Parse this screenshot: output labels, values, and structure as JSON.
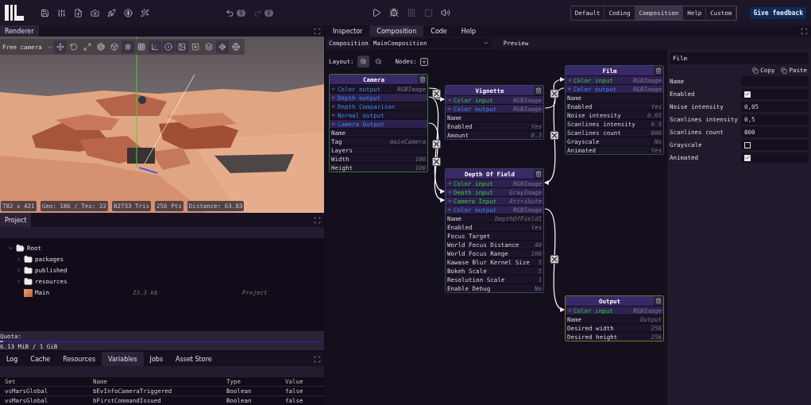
{
  "toolbar": {
    "undo_count": "0",
    "redo_count": "0",
    "layouts": [
      {
        "label": "Default",
        "selected": false
      },
      {
        "label": "Coding",
        "selected": false
      },
      {
        "label": "Composition",
        "selected": true
      },
      {
        "label": "Help",
        "selected": false
      },
      {
        "label": "Custom",
        "selected": false
      }
    ],
    "feedback": "Give feedback"
  },
  "renderer": {
    "tab": "Renderer",
    "camera": "Free camera",
    "tools": [
      {
        "selected": true
      },
      {
        "selected": false
      },
      {
        "selected": false
      },
      {
        "selected": false
      },
      {
        "selected": false
      },
      {
        "selected": true
      },
      {
        "selected": false
      },
      {
        "selected": true
      },
      {
        "selected": true
      },
      {
        "selected": true
      },
      {
        "selected": false
      },
      {
        "selected": false
      },
      {
        "selected": true
      },
      {
        "selected": false
      }
    ],
    "stats": [
      "782 x 421",
      "Geo: 186 / Tex: 22",
      "82733 Tris",
      "256 Pts",
      "Distance: 63.83"
    ]
  },
  "project": {
    "tab": "Project",
    "tree": [
      {
        "label": "Root",
        "kind": "folder",
        "expanded": true,
        "children": [
          {
            "label": "packages",
            "kind": "folder",
            "expanded": false
          },
          {
            "label": "published",
            "kind": "folder",
            "expanded": false
          },
          {
            "label": "resources",
            "kind": "folder",
            "expanded": false
          },
          {
            "label": "Main",
            "kind": "file",
            "size": "23.3 kb",
            "type": "Project"
          }
        ]
      }
    ],
    "quota_label": "Quota:",
    "quota": "6.13 MiB / 1 GiB",
    "quota_bar": {
      "level": 0.006
    }
  },
  "bottom": {
    "tabs": [
      {
        "label": "Log",
        "selected": false
      },
      {
        "label": "Cache",
        "selected": false
      },
      {
        "label": "Resources",
        "selected": false
      },
      {
        "label": "Variables",
        "selected": true
      },
      {
        "label": "Jobs",
        "selected": false
      },
      {
        "label": "Asset Store",
        "selected": false
      }
    ],
    "columns": [
      "Set",
      "Name",
      "Type",
      "Value"
    ],
    "rows": [
      [
        "vsMarsGlobal",
        "bEvInfoCameraTriggered",
        "Boolean",
        "false"
      ],
      [
        "vsMarsGlobal",
        "bFirstCommandIssued",
        "Boolean",
        "false"
      ]
    ]
  },
  "editor": {
    "tabs": [
      {
        "label": "Inspector",
        "selected": false
      },
      {
        "label": "Composition",
        "selected": true
      },
      {
        "label": "Code",
        "selected": false
      },
      {
        "label": "Help",
        "selected": false
      }
    ],
    "composition_label": "Composition",
    "composition": "MainComposition",
    "preview": "Preview",
    "layout_label": "Layout:",
    "nodes_label": "Nodes:",
    "nodes": [
      {
        "title": "Camera",
        "color": "#2e7d32",
        "rows": [
          {
            "kind": "output",
            "label": "Color output",
            "value": "RGBImage",
            "highlighted": false
          },
          {
            "kind": "output",
            "label": "Depth output",
            "highlighted": true
          },
          {
            "kind": "output",
            "label": "Depth Comparison",
            "highlighted": false
          },
          {
            "kind": "output",
            "label": "Normal output",
            "highlighted": false
          },
          {
            "kind": "output",
            "label": "Camera Output",
            "highlighted": true
          },
          {
            "kind": "property",
            "label": "Name"
          },
          {
            "kind": "property",
            "label": "Tag",
            "value": "mainCamera"
          },
          {
            "kind": "property",
            "label": "Layers"
          },
          {
            "kind": "property",
            "label": "Width",
            "value": "100"
          },
          {
            "kind": "property",
            "label": "Height",
            "value": "100"
          }
        ]
      },
      {
        "title": "Vignette",
        "color": "#2f4a5e",
        "rows": [
          {
            "kind": "input",
            "label": "Color input",
            "value": "RGBImage",
            "highlighted": true
          },
          {
            "kind": "output",
            "label": "Color output",
            "value": "RGBImage",
            "highlighted": true
          },
          {
            "kind": "property",
            "label": "Name"
          },
          {
            "kind": "property",
            "label": "Enabled",
            "value": "Yes"
          },
          {
            "kind": "property",
            "label": "Amount",
            "value": "0.3"
          }
        ]
      },
      {
        "title": "Film",
        "color": "#2f4a5e",
        "rows": [
          {
            "kind": "input",
            "label": "Color input",
            "value": "RGBImage",
            "highlighted": true
          },
          {
            "kind": "output",
            "label": "Color output",
            "value": "RGBImage",
            "highlighted": true
          },
          {
            "kind": "property",
            "label": "Name"
          },
          {
            "kind": "property",
            "label": "Enabled",
            "value": "Yes"
          },
          {
            "kind": "property",
            "label": "Noise intensity",
            "value": "0.05"
          },
          {
            "kind": "property",
            "label": "Scanlines intensity",
            "value": "0.5"
          },
          {
            "kind": "property",
            "label": "Scanlines count",
            "value": "800"
          },
          {
            "kind": "property",
            "label": "Grayscale",
            "value": "No"
          },
          {
            "kind": "property",
            "label": "Animated",
            "value": "Yes"
          }
        ]
      },
      {
        "title": "Depth Of Field",
        "color": "#2f4a5e",
        "rows": [
          {
            "kind": "input",
            "label": "Color input",
            "value": "RGBImage",
            "highlighted": true
          },
          {
            "kind": "input",
            "label": "Depth input",
            "value": "GrayImage",
            "highlighted": true
          },
          {
            "kind": "input",
            "label": "Camera Input",
            "value": "Attribute",
            "highlighted": true
          },
          {
            "kind": "output",
            "label": "Color output",
            "value": "RGBImage",
            "highlighted": true
          },
          {
            "kind": "property",
            "label": "Name",
            "value": "DepthOfField1"
          },
          {
            "kind": "property",
            "label": "Enabled",
            "value": "Yes"
          },
          {
            "kind": "property",
            "label": "Focus Target"
          },
          {
            "kind": "property",
            "label": "World Focus Distance",
            "value": "40"
          },
          {
            "kind": "property",
            "label": "World Focus Range",
            "value": "100"
          },
          {
            "kind": "property",
            "label": "Kawase Blur Kernel Size",
            "value": "5"
          },
          {
            "kind": "property",
            "label": "Bokeh Scale",
            "value": "5"
          },
          {
            "kind": "property",
            "label": "Resolution Scale",
            "value": "1"
          },
          {
            "kind": "property",
            "label": "Enable Debug",
            "value": "No"
          }
        ]
      },
      {
        "title": "Output",
        "color": "#76742a",
        "rows": [
          {
            "kind": "input",
            "label": "Color input",
            "value": "RGBImage",
            "highlighted": true
          },
          {
            "kind": "property",
            "label": "Name",
            "value": "Output"
          },
          {
            "kind": "property",
            "label": "Desired width",
            "value": "256"
          },
          {
            "kind": "property",
            "label": "Desired height",
            "value": "256"
          }
        ]
      }
    ]
  },
  "inspector": {
    "title": "Film",
    "copy": "Copy",
    "paste": "Paste",
    "fields": [
      {
        "kind": "text",
        "label": "Name"
      },
      {
        "kind": "checkbox",
        "label": "Enabled",
        "checked": true
      },
      {
        "kind": "text",
        "label": "Noise intensity",
        "value": "0,05"
      },
      {
        "kind": "text",
        "label": "Scanlines intensity",
        "value": "0,5"
      },
      {
        "kind": "text",
        "label": "Scanlines count",
        "value": "800"
      },
      {
        "kind": "checkbox",
        "label": "Grayscale",
        "checked": false
      },
      {
        "kind": "checkbox",
        "label": "Animated",
        "checked": true
      }
    ]
  }
}
